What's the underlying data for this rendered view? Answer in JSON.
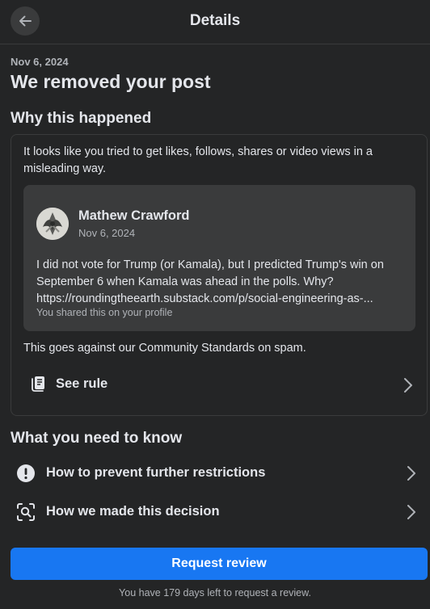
{
  "header": {
    "title": "Details",
    "back_icon": "arrow-left-icon"
  },
  "notice": {
    "date": "Nov 6, 2024",
    "headline": "We removed your post"
  },
  "why": {
    "title": "Why this happened",
    "description": "It looks like you tried to get likes, follows, shares or video views in a misleading way.",
    "post": {
      "author": "Mathew Crawford",
      "date": "Nov 6, 2024",
      "lines": [
        "I did not vote for Trump (or Kamala), but I predicted Trump's win on",
        "September 6 when Kamala was ahead in the polls. Why?",
        "https://roundingtheearth.substack.com/p/social-engineering-as-..."
      ],
      "shared_note": "You shared this on your profile"
    },
    "standards": "This goes against our Community Standards on spam.",
    "see_rule": "See rule"
  },
  "know": {
    "title": "What you need to know",
    "items": [
      {
        "label": "How to prevent further restrictions",
        "icon": "exclamation-circle-icon"
      },
      {
        "label": "How we made this decision",
        "icon": "magnify-scan-icon"
      }
    ]
  },
  "footer": {
    "button_label": "Request review",
    "note": "You have 179 days left to request a review."
  },
  "colors": {
    "background": "#242526",
    "surface": "#3a3b3c",
    "primary": "#1877f2",
    "text": "#e4e6eb",
    "secondary_text": "#b0b3b8"
  }
}
